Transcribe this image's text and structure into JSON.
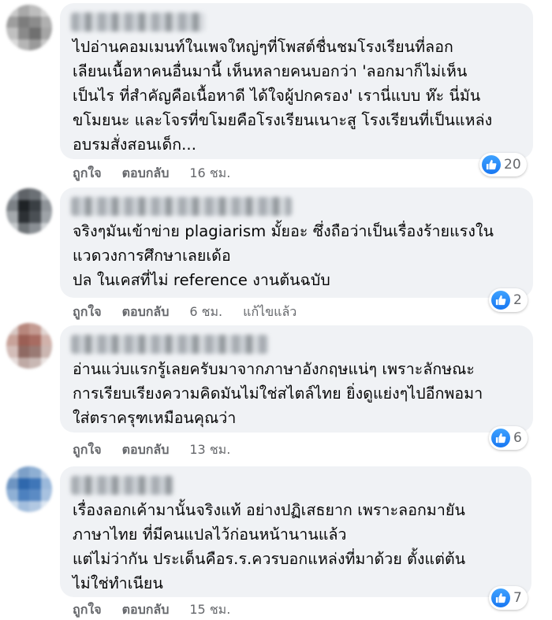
{
  "comments": [
    {
      "text": "ไปอ่านคอมเมนท์ในเพจใหญ่ๆที่โพสต์ชื่นชมโรงเรียนที่ลอก\nเลียนเนื้อหาคนอื่นมานี้ เห็นหลายคนบอกว่า 'ลอกมาก็ไม่เห็น\nเป็นไร ที่สำคัญคือเนื้อหาดี ได้ใจผู้ปกครอง' เรานี่แบบ ห๊ะ นี่มัน\nขโมยนะ และโจรที่ขโมยคือโรงเรียนเนาะสู โรงเรียนที่เป็นแหล่ง\nอบรมสั่งสอนเด็ก...",
      "reactions": "20",
      "like_label": "ถูกใจ",
      "reply_label": "ตอบกลับ",
      "time": "16 ชม."
    },
    {
      "text": "จริงๆมันเข้าข่าย plagiarism มั้ยอะ ซึ่งถือว่าเป็นเรื่องร้ายแรงใน\nแวดวงการศึกษาเลยเด้อ\nปล ในเคสที่ไม่ reference งานต้นฉบับ",
      "reactions": "2",
      "like_label": "ถูกใจ",
      "reply_label": "ตอบกลับ",
      "time": "6 ชม.",
      "edited": "แก้ไขแล้ว"
    },
    {
      "text": "อ่านแว่บแรกรู้เลยครับมาจากภาษาอังกฤษแน่ๆ เพราะลักษณะ\nการเรียบเรียงความคิดมันไม่ใช่สไตล์ไทย ยิ่งดูแย่งๆไปอีกพอมา\nใส่ตราครุฑเหมือนคุณว่า",
      "reactions": "6",
      "like_label": "ถูกใจ",
      "reply_label": "ตอบกลับ",
      "time": "13 ชม."
    },
    {
      "text": "เรื่องลอกเค้ามานั้นจริงแท้ อย่างปฏิเสธยาก เพราะลอกมายัน\nภาษาไทย ที่มีคนแปลไว้ก่อนหน้านานแล้ว\nแต่ไม่ว่ากัน ประเด็นคือร.ร.ควรบอกแหล่งที่มาด้วย ตั้งแต่ต้น\nไม่ใช่ทำเนียน",
      "reactions": "7",
      "like_label": "ถูกใจ",
      "reply_label": "ตอบกลับ",
      "time": "15 ชม."
    }
  ],
  "colors": {
    "like_blue": "#1877f2",
    "bubble": "#f0f2f5",
    "meta": "#65676b"
  },
  "icons": {
    "reaction": "thumbs-up-icon"
  }
}
